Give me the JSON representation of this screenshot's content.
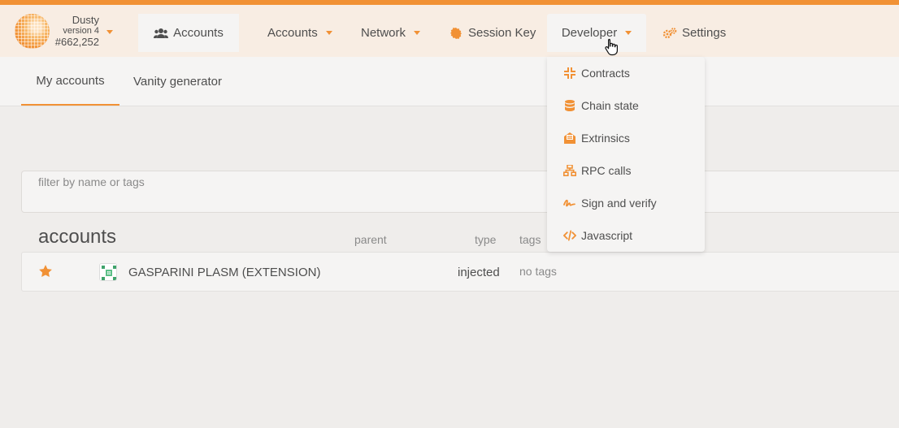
{
  "chain": {
    "name": "Dusty",
    "version": "version 4",
    "block": "#662,252"
  },
  "nav": {
    "accounts_tab": "Accounts",
    "accounts_menu": "Accounts",
    "network_menu": "Network",
    "session_key": "Session Key",
    "developer_menu": "Developer",
    "settings": "Settings"
  },
  "subtabs": {
    "my_accounts": "My accounts",
    "vanity_generator": "Vanity generator"
  },
  "filter": {
    "placeholder": "filter by name or tags",
    "value": ""
  },
  "table": {
    "title": "accounts",
    "columns": {
      "parent": "parent",
      "type": "type",
      "tags": "tags"
    },
    "rows": [
      {
        "name": "GASPARINI PLASM (EXTENSION)",
        "type": "injected",
        "tags": "no tags",
        "favorite": true
      }
    ]
  },
  "developer_dropdown": {
    "items": [
      {
        "label": "Contracts",
        "icon": "compress-icon"
      },
      {
        "label": "Chain state",
        "icon": "database-icon"
      },
      {
        "label": "Extrinsics",
        "icon": "envelope-open-text-icon"
      },
      {
        "label": "RPC calls",
        "icon": "network-wired-icon"
      },
      {
        "label": "Sign and verify",
        "icon": "signature-icon"
      },
      {
        "label": "Javascript",
        "icon": "code-icon"
      }
    ]
  },
  "colors": {
    "accent": "#f19135",
    "header_bg": "#f8ede3",
    "page_bg": "#efedeb",
    "panel_bg": "#f5f4f3"
  }
}
